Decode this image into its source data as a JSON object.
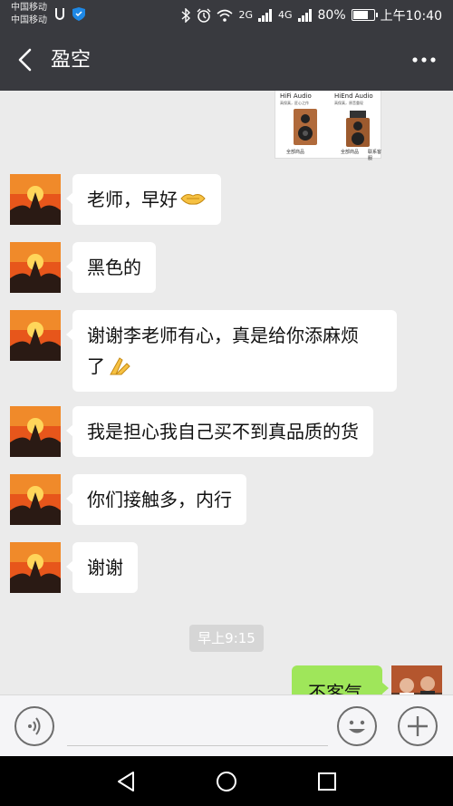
{
  "status_bar": {
    "carrier_1": "中国移动",
    "carrier_2": "中国移动",
    "signal_1_tag": "2G",
    "signal_2_tag": "4G",
    "battery_percent": "80%",
    "battery_level": 0.8,
    "time": "上午10:40"
  },
  "header": {
    "title": "盈空",
    "icons": {
      "back": "chevron-left-icon",
      "more": "more-dots-icon"
    }
  },
  "chat": {
    "shared_image": {
      "left_brand": "HiFi Audio",
      "left_tagline": "高保真，匠心之作",
      "left_footer": "全部商品",
      "right_brand": "HiEnd Audio",
      "right_tagline": "高保真，原音重现",
      "right_footer": "全部商品",
      "right_footer_2": "联系客服"
    },
    "incoming": [
      {
        "text": "老师，早好",
        "emoji": "handshake-emoji"
      },
      {
        "text": "黑色的"
      },
      {
        "text": "谢谢李老师有心，真是给你添麻烦",
        "text_line2": "了",
        "emoji": "praying-hands-emoji"
      },
      {
        "text": "我是担心我自己买不到真品质的货"
      },
      {
        "text": "你们接触多，内行"
      },
      {
        "text": "谢谢"
      }
    ],
    "timestamp": "早上9:15",
    "outgoing": [
      {
        "text": "不客气"
      }
    ]
  },
  "input_bar": {
    "icons": {
      "voice": "voice-icon",
      "emoji": "emoji-icon",
      "plus": "plus-icon"
    },
    "placeholder": ""
  },
  "nav_bar": {
    "icons": {
      "back": "triangle-back-icon",
      "home": "circle-home-icon",
      "recent": "square-recent-icon"
    }
  },
  "colors": {
    "header_bg": "#393a3f",
    "chat_bg": "#ebebeb",
    "incoming_bubble": "#ffffff",
    "outgoing_bubble": "#9fe65a"
  }
}
